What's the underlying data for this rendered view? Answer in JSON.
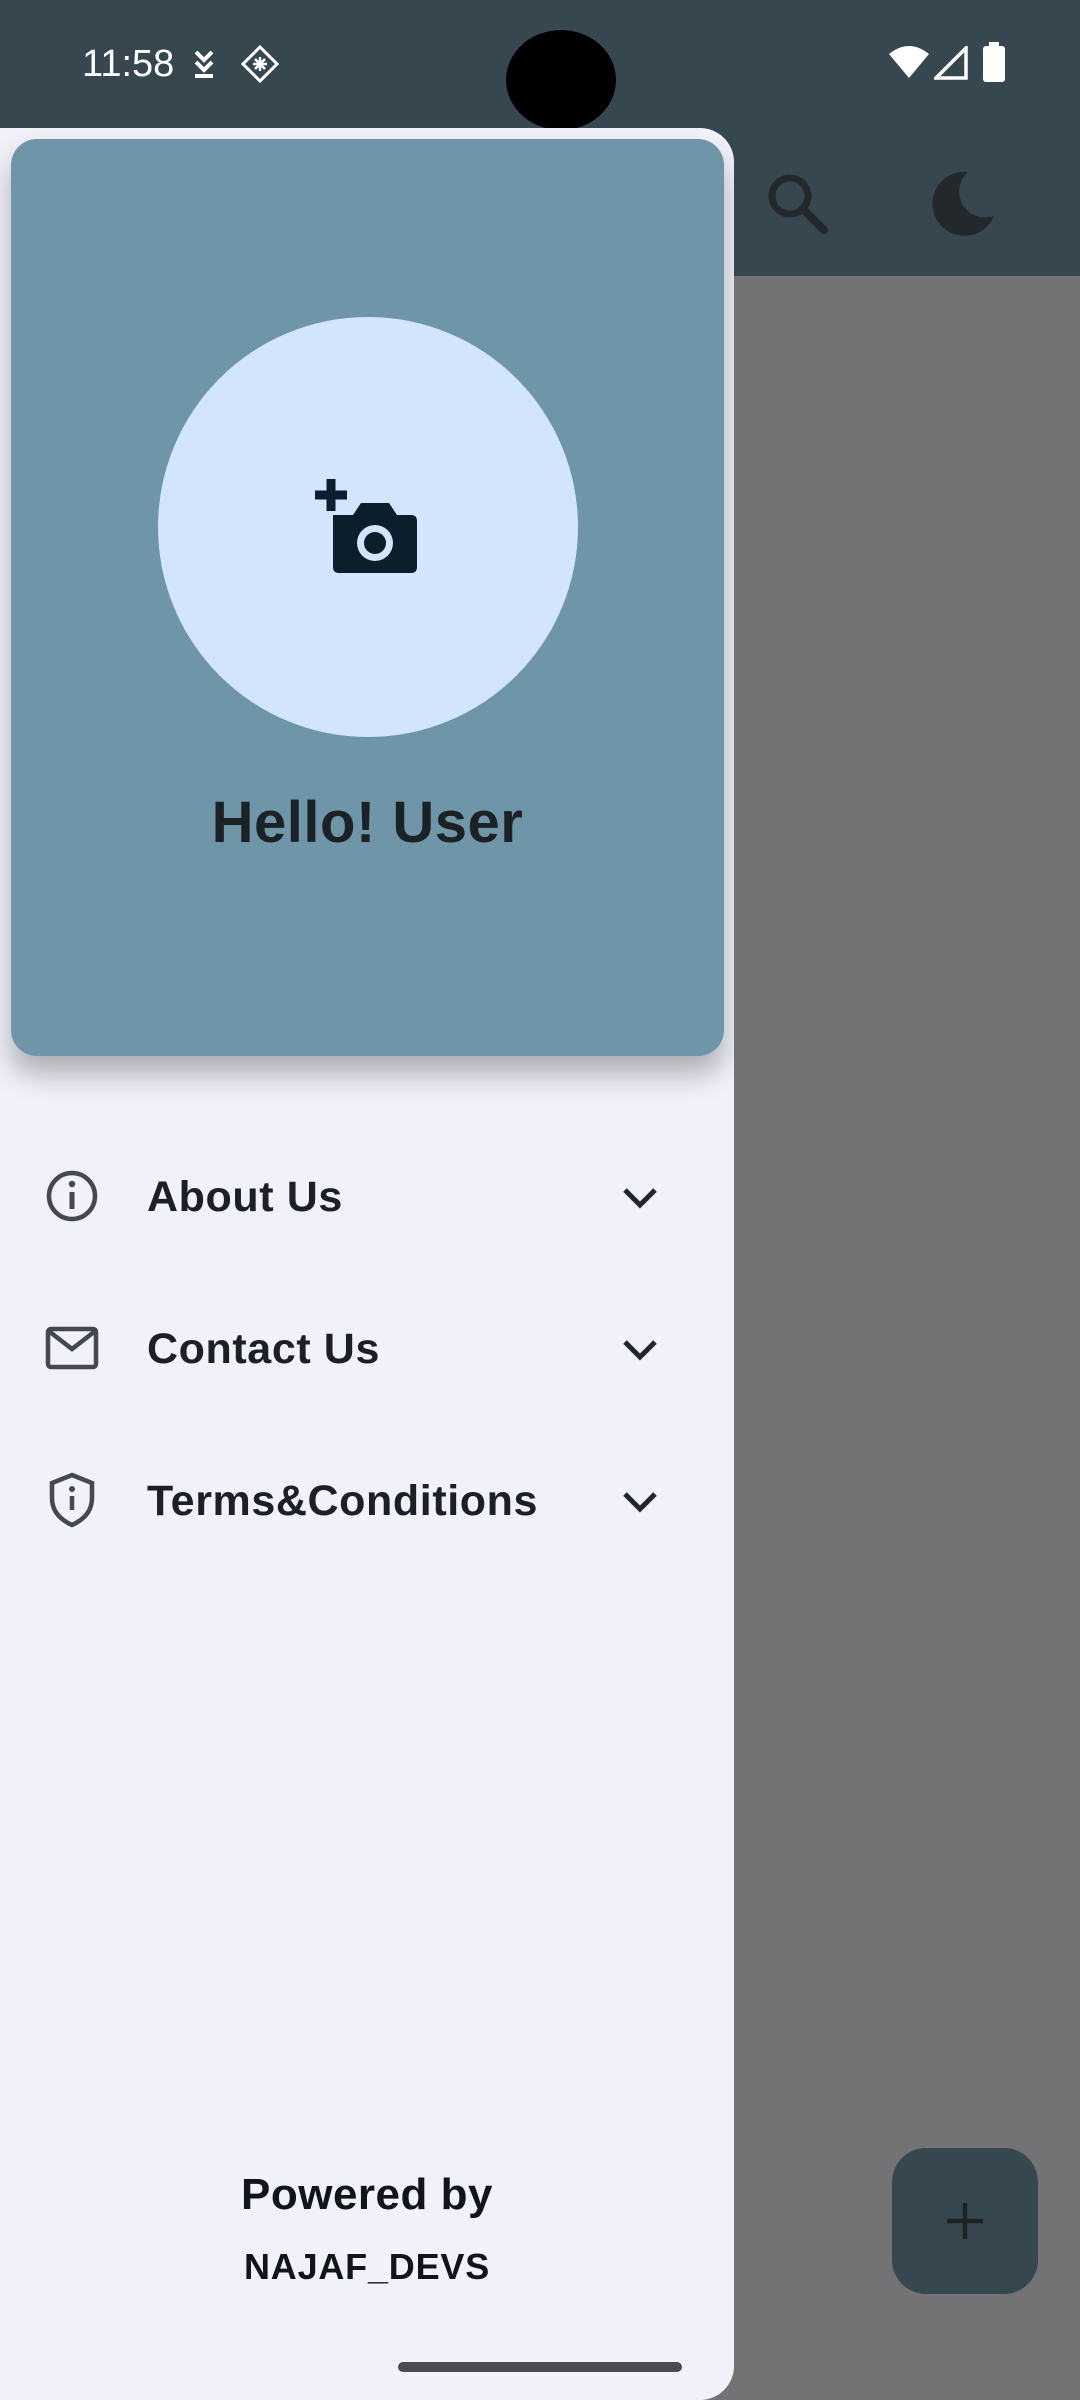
{
  "status_bar": {
    "time": "11:58",
    "icons": [
      "download-status-icon",
      "app-grid-icon",
      "wifi-icon",
      "signal-icon",
      "battery-icon"
    ]
  },
  "app_bar": {
    "icons": [
      "search-icon",
      "dark-mode-icon"
    ]
  },
  "drawer": {
    "header": {
      "avatar_icon": "add-photo-icon",
      "greeting": "Hello! User"
    },
    "menu_items": [
      {
        "label": "About Us",
        "icon": "info-icon"
      },
      {
        "label": "Contact Us",
        "icon": "mail-icon"
      },
      {
        "label": "Terms&Conditions",
        "icon": "shield-icon"
      }
    ],
    "footer": {
      "powered_by": "Powered by",
      "developer": "NAJAF_DEVS"
    }
  },
  "fab": {
    "icon": "add-icon"
  },
  "colors": {
    "status_bar": "#37474f",
    "drawer_header": "#6f96a8",
    "avatar_bg": "#d3e4fd",
    "drawer_bg": "#f0f1f9",
    "scrim": "#737375"
  }
}
